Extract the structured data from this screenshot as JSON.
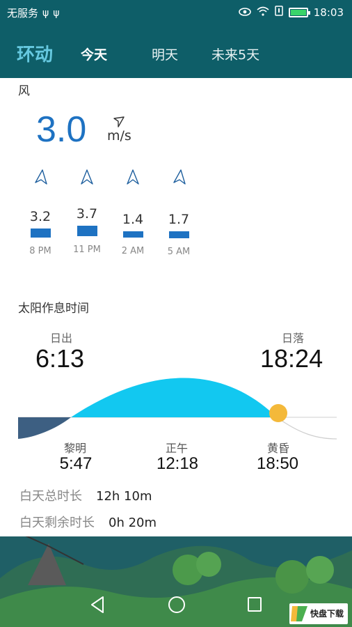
{
  "status_bar": {
    "carrier": "无服务",
    "time": "18:03"
  },
  "app": {
    "title": "环动"
  },
  "tabs": [
    {
      "label": "今天",
      "active": true
    },
    {
      "label": "明天",
      "active": false
    },
    {
      "label": "未来5天",
      "active": false
    }
  ],
  "wind": {
    "section_title": "风",
    "current_speed": "3.0",
    "unit": "m/s",
    "forecast": [
      {
        "time": "8 PM",
        "speed": "3.2"
      },
      {
        "time": "11 PM",
        "speed": "3.7"
      },
      {
        "time": "2 AM",
        "speed": "1.4"
      },
      {
        "time": "5 AM",
        "speed": "1.7"
      }
    ]
  },
  "sun": {
    "section_title": "太阳作息时间",
    "sunrise_label": "日出",
    "sunrise_time": "6:13",
    "sunset_label": "日落",
    "sunset_time": "18:24",
    "dawn_label": "黎明",
    "dawn_time": "5:47",
    "noon_label": "正午",
    "noon_time": "12:18",
    "dusk_label": "黄昏",
    "dusk_time": "18:50",
    "total_daylight_label": "白天总时长",
    "total_daylight_value": "12h 10m",
    "remaining_daylight_label": "白天剩余时长",
    "remaining_daylight_value": "0h 20m"
  },
  "watermark": {
    "text": "快盘下载"
  },
  "colors": {
    "header_bg": "#0e5e68",
    "accent_blue": "#1e72c2",
    "sun_arc": "#12c8f0",
    "sun_dot": "#f4b93a",
    "night_fill": "#3d5f82"
  }
}
